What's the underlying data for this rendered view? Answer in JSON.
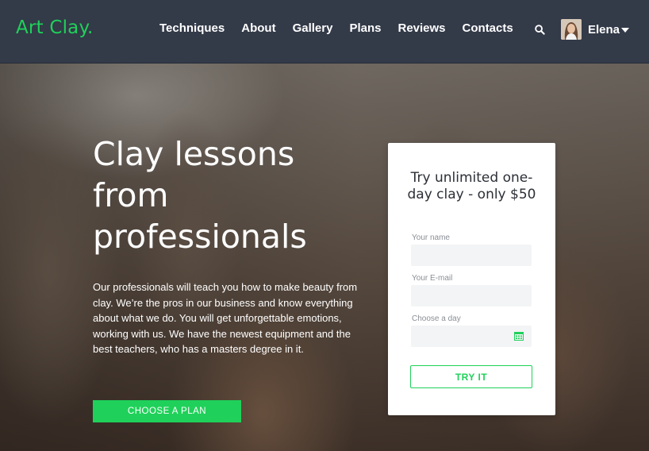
{
  "brand": {
    "logo": "Art Clay."
  },
  "nav": {
    "items": [
      "Techniques",
      "About",
      "Gallery",
      "Plans",
      "Reviews",
      "Contacts"
    ]
  },
  "user": {
    "name": "Elena"
  },
  "hero": {
    "title": "Clay lessons from professionals",
    "text": "Our professionals will teach you how to make beauty from clay. We’re the pros in our business and know everything about what we do. You will get unforgettable emotions, working with us. We have the newest equipment and the best teachers, who has a masters degree in it.",
    "cta": "CHOOSE A PLAN"
  },
  "form": {
    "title": "Try unlimited one-day clay - only $50",
    "name_label": "Your name",
    "name_value": "",
    "email_label": "Your E-mail",
    "email_value": "",
    "day_label": "Choose a day",
    "day_value": "",
    "submit": "TRY IT"
  },
  "colors": {
    "accent": "#1fd15a",
    "header_bg": "#333a48",
    "card_bg": "#ffffff"
  },
  "icons": [
    "search-icon",
    "chevron-down-icon",
    "calendar-icon"
  ]
}
